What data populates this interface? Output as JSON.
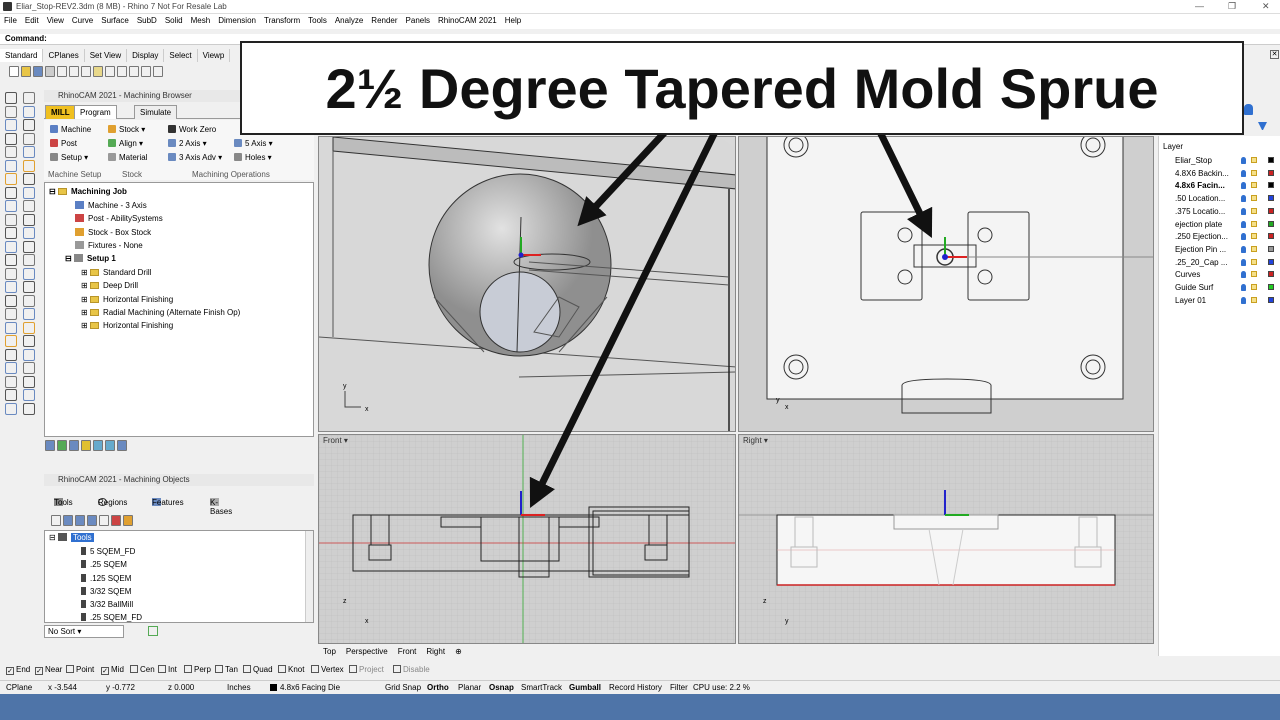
{
  "window": {
    "title": "Eliar_Stop-REV2.3dm (8 MB) - Rhino 7 Not For Resale Lab"
  },
  "menu": [
    "File",
    "Edit",
    "View",
    "Curve",
    "Surface",
    "SubD",
    "Solid",
    "Mesh",
    "Dimension",
    "Transform",
    "Tools",
    "Analyze",
    "Render",
    "Panels",
    "RhinoCAM 2021",
    "Help"
  ],
  "command": {
    "label": "Command:"
  },
  "toolbar_tabs": [
    "Standard",
    "CPlanes",
    "Set View",
    "Display",
    "Select",
    "Viewp"
  ],
  "banner": {
    "text": "2½ Degree Tapered Mold Sprue"
  },
  "cam": {
    "browser_title": "RhinoCAM 2021 - Machining Browser",
    "tabs": {
      "mill": "MILL",
      "program": "Program",
      "simulate": "Simulate"
    },
    "ribbon": {
      "machine": "Machine",
      "post": "Post",
      "setup": "Setup",
      "stock": "Stock",
      "align": "Align",
      "material": "Material",
      "work_zero": "Work Zero",
      "two_axis": "2 Axis",
      "three_axis_adv": "3 Axis Adv",
      "five_axis": "5 Axis",
      "holes": "Holes",
      "sec_setup": "Machine Setup",
      "sec_stock": "Stock",
      "sec_ops": "Machining Operations"
    },
    "tree": {
      "job": "Machining Job",
      "machine": "Machine - 3 Axis",
      "post": "Post - AbilitySystems",
      "stock": "Stock - Box Stock",
      "fixtures": "Fixtures - None",
      "setup": "Setup 1",
      "ops": [
        "Standard Drill",
        "Deep Drill",
        "Horizontal Finishing",
        "Radial Machining (Alternate Finish Op)",
        "Horizontal Finishing"
      ]
    },
    "objects_title": "RhinoCAM 2021 - Machining Objects",
    "obj_tabs": {
      "tools": "Tools",
      "regions": "Regions",
      "features": "Features",
      "kbases": "K-Bases"
    },
    "tools_root": "Tools",
    "tools": [
      "5 SQEM_FD",
      ".25 SQEM",
      ".125 SQEM",
      "3/32 SQEM",
      "3/32 BallMill",
      ".25 SQEM_FD"
    ],
    "sort": "No Sort"
  },
  "viewports": {
    "front": "Front",
    "right": "Right"
  },
  "viewport_tabs": [
    "Top",
    "Perspective",
    "Front",
    "Right"
  ],
  "layers": {
    "header": "Layer",
    "items": [
      {
        "name": "Eliar_Stop",
        "color": "#000000"
      },
      {
        "name": "4.8X6 Backin...",
        "color": "#cc2222"
      },
      {
        "name": "4.8x6 Facin...",
        "color": "#000000"
      },
      {
        "name": ".50 Location...",
        "color": "#2244dd"
      },
      {
        "name": ".375 Locatio...",
        "color": "#cc2222"
      },
      {
        "name": "ejection plate",
        "color": "#22aa22"
      },
      {
        "name": ".250 Ejection...",
        "color": "#cc2222"
      },
      {
        "name": "Ejection Pin ...",
        "color": "#999999"
      },
      {
        "name": ".25_20_Cap ...",
        "color": "#2244dd"
      },
      {
        "name": "Curves",
        "color": "#cc2222"
      },
      {
        "name": "Guide Surf",
        "color": "#22cc22"
      },
      {
        "name": "Layer 01",
        "color": "#2244dd"
      }
    ]
  },
  "osnap": [
    "End",
    "Near",
    "Point",
    "Mid",
    "Cen",
    "Int",
    "Perp",
    "Tan",
    "Quad",
    "Knot",
    "Vertex",
    "Project",
    "Disable"
  ],
  "status": {
    "cplane": "CPlane",
    "x": "x -3.544",
    "y": "y -0.772",
    "z": "z 0.000",
    "units": "Inches",
    "layer": "4.8x6 Facing Die",
    "grid_snap": "Grid Snap",
    "ortho": "Ortho",
    "planar": "Planar",
    "osnap": "Osnap",
    "smarttrack": "SmartTrack",
    "gumball": "Gumball",
    "record": "Record History",
    "filter": "Filter",
    "cpu": "CPU use: 2.2 %"
  }
}
